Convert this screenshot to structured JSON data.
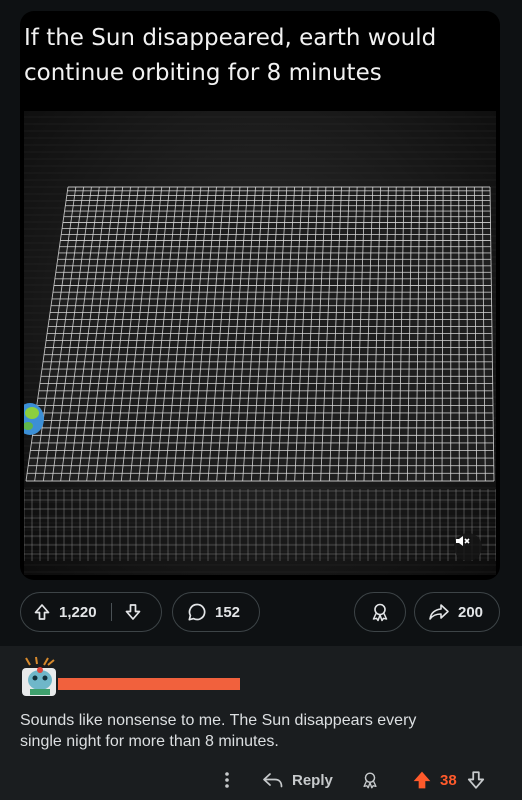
{
  "post": {
    "caption": "If the Sun disappeared, earth would\ncontinue orbiting for 8 minutes",
    "upvotes": "1,220",
    "comments": "152",
    "shares": "200"
  },
  "comment": {
    "text": "Sounds like nonsense to me. The Sun disappears every\nsingle night for more than 8 minutes.",
    "reply_label": "Reply",
    "score": "38"
  },
  "colors": {
    "background": "#0e1113",
    "comment_background": "#1a1d1f",
    "upvote_active": "#ff5a2b",
    "redaction": "#f1613d",
    "grid_line": "#d8d8d8"
  }
}
